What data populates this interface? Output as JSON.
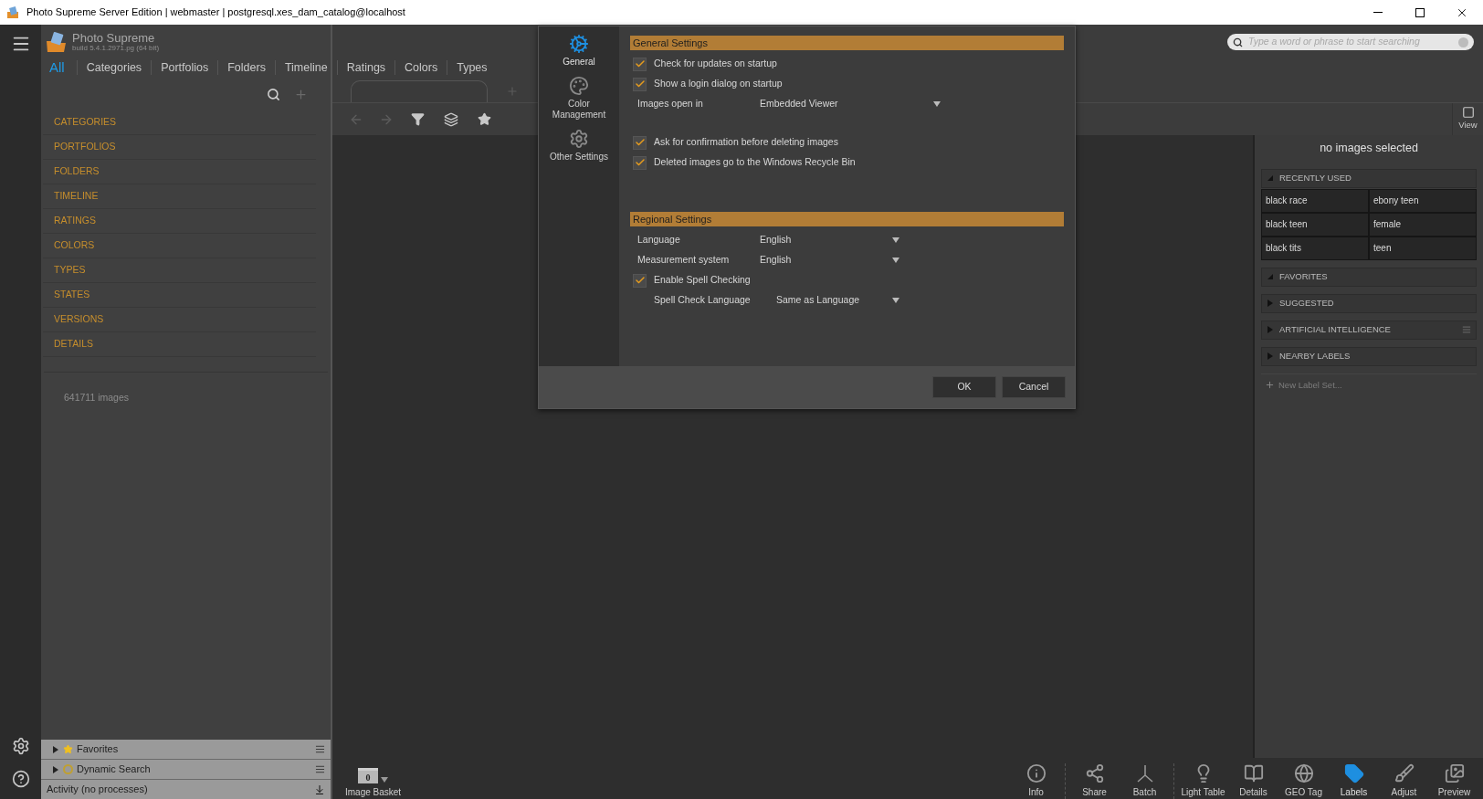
{
  "window": {
    "title": "Photo Supreme Server Edition | webmaster | postgresql.xes_dam_catalog@localhost"
  },
  "app": {
    "name": "Photo Supreme",
    "build": "build 5.4.1.2971.pg (64 bit)"
  },
  "nav_tabs": [
    {
      "label": "All",
      "selected": true
    },
    {
      "label": "Categories",
      "selected": false
    },
    {
      "label": "Portfolios",
      "selected": false
    },
    {
      "label": "Folders",
      "selected": false
    },
    {
      "label": "Timeline",
      "selected": false
    },
    {
      "label": "Ratings",
      "selected": false
    },
    {
      "label": "Colors",
      "selected": false
    },
    {
      "label": "Types",
      "selected": false
    }
  ],
  "sidebar": {
    "items": [
      "CATEGORIES",
      "PORTFOLIOS",
      "FOLDERS",
      "TIMELINE",
      "RATINGS",
      "COLORS",
      "TYPES",
      "STATES",
      "VERSIONS",
      "DETAILS"
    ],
    "count": "641711 images"
  },
  "bottom_panels": [
    {
      "label": "Favorites",
      "kind": "star"
    },
    {
      "label": "Dynamic Search",
      "kind": "dynamic"
    }
  ],
  "activity": "Activity (no processes)",
  "dialog": {
    "nav": [
      {
        "label": "General",
        "selected": true
      },
      {
        "label": "Color Management",
        "selected": false
      },
      {
        "label": "Other Settings",
        "selected": false
      }
    ],
    "sections": [
      {
        "title": "General Settings",
        "groups": [
          [
            {
              "kind": "checkbox",
              "label": "Check for updates on startup",
              "checked": true
            },
            {
              "kind": "checkbox",
              "label": "Show a login dialog on startup",
              "checked": true
            },
            {
              "kind": "select",
              "label": "Images open in",
              "value": "Embedded Viewer"
            }
          ],
          [
            {
              "kind": "checkbox",
              "label": "Ask for confirmation before deleting images",
              "checked": true
            },
            {
              "kind": "checkbox",
              "label": "Deleted images go to the Windows Recycle Bin",
              "checked": true
            }
          ]
        ]
      },
      {
        "title": "Regional Settings",
        "groups": [
          [
            {
              "kind": "select",
              "label": "Language",
              "value": "English"
            },
            {
              "kind": "select",
              "label": "Measurement system",
              "value": "English"
            },
            {
              "kind": "checkbox",
              "label": "Enable Spell Checking",
              "checked": true,
              "children": [
                {
                  "kind": "select",
                  "label": "Spell Check Language",
                  "value": "Same as Language"
                }
              ]
            }
          ]
        ]
      }
    ],
    "buttons": [
      "OK",
      "Cancel"
    ]
  },
  "search": {
    "placeholder": "Type a word or phrase to start searching"
  },
  "right_panel": {
    "view_label": "View",
    "status": "no images selected",
    "label_sets": [
      {
        "title": "RECENTLY USED",
        "expanded": true,
        "has_menu": false,
        "labels": [
          "black race",
          "ebony teen",
          "black teen",
          "female",
          "black tits",
          "teen"
        ]
      },
      {
        "title": "FAVORITES",
        "expanded": true,
        "has_menu": false
      },
      {
        "title": "SUGGESTED",
        "expanded": false,
        "has_menu": false
      },
      {
        "title": "ARTIFICIAL INTELLIGENCE",
        "expanded": false,
        "has_menu": true
      },
      {
        "title": "NEARBY LABELS",
        "expanded": false,
        "has_menu": false
      }
    ],
    "new_label_set": "New Label Set..."
  },
  "image_basket": {
    "count": "0",
    "label": "Image Basket"
  },
  "toolbar_groups": [
    [
      {
        "label": "Info",
        "selected": false
      }
    ],
    [
      {
        "label": "Share",
        "selected": false
      },
      {
        "label": "Batch",
        "selected": false
      }
    ],
    [
      {
        "label": "Light Table",
        "selected": false
      },
      {
        "label": "Details",
        "selected": false
      },
      {
        "label": "GEO Tag",
        "selected": false
      },
      {
        "label": "Labels",
        "selected": true
      },
      {
        "label": "Adjust",
        "selected": false
      },
      {
        "label": "Preview",
        "selected": false
      }
    ]
  ]
}
